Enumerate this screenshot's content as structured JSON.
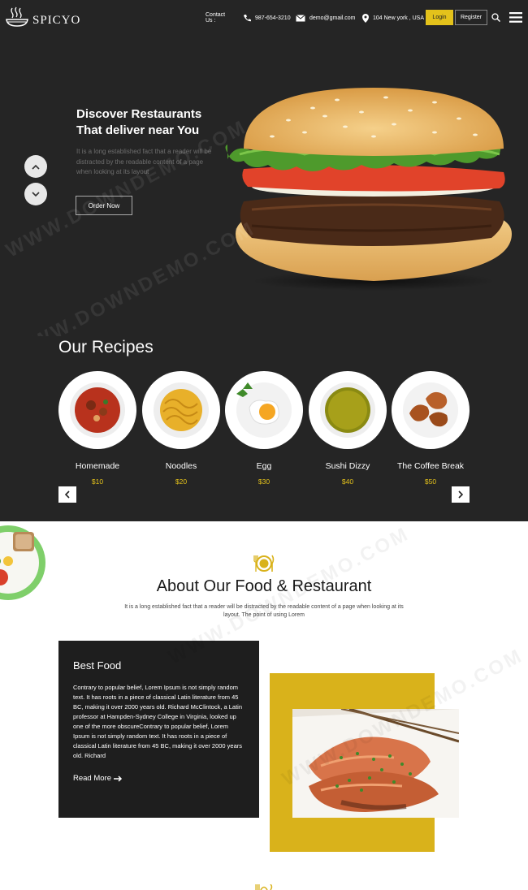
{
  "header": {
    "logo_text": "SPICYO",
    "contact_label": "Contact Us :",
    "phone": "987-654-3210",
    "email": "demo@gmail.com",
    "address": "104 New york , USA",
    "login_label": "Login",
    "register_label": "Register"
  },
  "hero": {
    "title_line1": "Discover Restaurants",
    "title_line2": "That deliver near You",
    "text": "It is a long established fact that a reader will be distracted by the readable content of a page when looking at its layout",
    "order_button": "Order Now"
  },
  "recipes": {
    "title": "Our Recipes",
    "items": [
      {
        "name": "Homemade",
        "price": "$10"
      },
      {
        "name": "Noodles",
        "price": "$20"
      },
      {
        "name": "Egg",
        "price": "$30"
      },
      {
        "name": "Sushi Dizzy",
        "price": "$40"
      },
      {
        "name": "The Coffee Break",
        "price": "$50"
      }
    ]
  },
  "about": {
    "title": "About Our Food & Restaurant",
    "subtitle": "It is a long established fact that a reader will be distracted by the readable content of a page when looking at its layout. The point of using Lorem",
    "card_title": "Best Food",
    "card_text": "Contrary to popular belief, Lorem Ipsum is not simply random text. It has roots in a piece of classical Latin literature from 45 BC, making it over 2000 years old. Richard McClintock, a Latin professor at Hampden-Sydney College in Virginia, looked up one of the more obscureContrary to popular belief, Lorem Ipsum is not simply random text. It has roots in a piece of classical Latin literature from 45 BC, making it over 2000 years old. Richard",
    "read_more": "Read More"
  },
  "colors": {
    "dark_bg": "#252525",
    "accent": "#e4c21b",
    "card_bg": "#1e1e1e",
    "yellow_box": "#d9b21b"
  },
  "icons": [
    "logo-bowl-icon",
    "phone-icon",
    "mail-icon",
    "location-icon",
    "search-icon",
    "menu-icon",
    "arrow-up-icon",
    "arrow-down-icon",
    "chevron-left-icon",
    "chevron-right-icon",
    "plate-cutlery-icon",
    "arrow-right-icon"
  ]
}
